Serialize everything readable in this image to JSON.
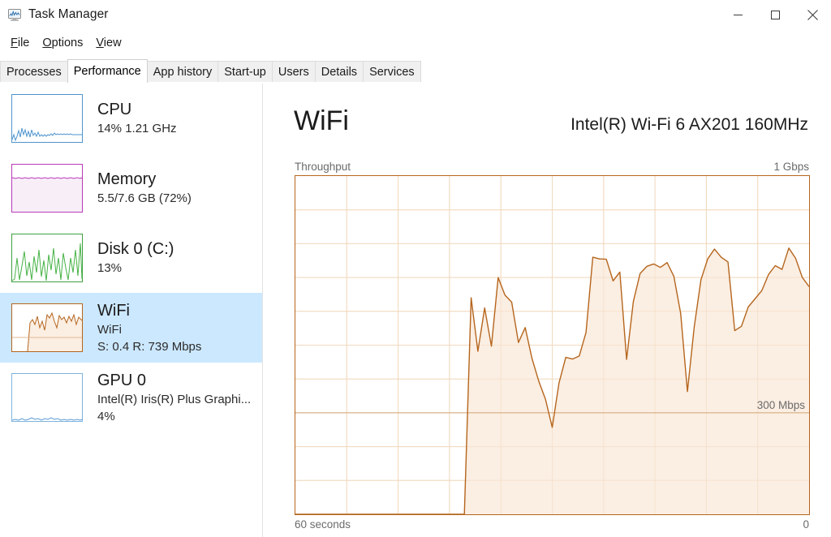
{
  "window": {
    "title": "Task Manager",
    "icon": "task-manager-icon",
    "buttons": {
      "minimize": "minimize-icon",
      "maximize": "maximize-icon",
      "close": "close-icon"
    }
  },
  "menu": {
    "items": [
      {
        "label": "File",
        "accel": "F"
      },
      {
        "label": "Options",
        "accel": "O"
      },
      {
        "label": "View",
        "accel": "V"
      }
    ]
  },
  "tabs": {
    "items": [
      {
        "label": "Processes",
        "active": false
      },
      {
        "label": "Performance",
        "active": true
      },
      {
        "label": "App history",
        "active": false
      },
      {
        "label": "Start-up",
        "active": false
      },
      {
        "label": "Users",
        "active": false
      },
      {
        "label": "Details",
        "active": false
      },
      {
        "label": "Services",
        "active": false
      }
    ]
  },
  "sidebar": {
    "items": [
      {
        "name": "cpu",
        "title": "CPU",
        "sub1": "14%  1.21 GHz",
        "sub2": "",
        "accent": "#4f94cd",
        "fill": "#ffffff",
        "selected": false
      },
      {
        "name": "memory",
        "title": "Memory",
        "sub1": "5.5/7.6 GB (72%)",
        "sub2": "",
        "accent": "#b83bb8",
        "fill": "#f8eef8",
        "selected": false
      },
      {
        "name": "disk-0",
        "title": "Disk 0 (C:)",
        "sub1": "13%",
        "sub2": "",
        "accent": "#3fa03f",
        "fill": "#ffffff",
        "selected": false
      },
      {
        "name": "wifi",
        "title": "WiFi",
        "sub1": "WiFi",
        "sub2": "S: 0.4 R: 739 Mbps",
        "accent": "#b5651d",
        "fill": "#fbeee2",
        "selected": true
      },
      {
        "name": "gpu-0",
        "title": "GPU 0",
        "sub1": "Intel(R) Iris(R) Plus Graphi...",
        "sub2": "4%",
        "accent": "#5b9bd5",
        "fill": "#ffffff",
        "selected": false
      }
    ],
    "selection_color": "#cce8ff"
  },
  "main": {
    "title": "WiFi",
    "adapter": "Intel(R) Wi-Fi 6 AX201 160MHz",
    "graph_caption_left": "Throughput",
    "graph_caption_right": "1 Gbps",
    "midline_label": "300 Mbps",
    "axis_left": "60 seconds",
    "axis_right": "0",
    "line_color": "#b5651d",
    "fill_color": "#fbeee2",
    "grid_color": "#f2d9bf"
  },
  "chart_data": {
    "type": "area",
    "title": "Throughput",
    "xlabel": "",
    "ylabel": "Throughput",
    "ylim": [
      0,
      1000
    ],
    "xlim": [
      60,
      0
    ],
    "y_unit": "Mbps",
    "y_max_label": "1 Gbps",
    "y_mid_label": "300 Mbps",
    "y_mid_value": 300,
    "x_left_label": "60 seconds",
    "x_right_label": "0",
    "grid": true,
    "legend": "none",
    "series": [
      {
        "name": "Throughput",
        "color": "#b5651d",
        "x": [
          60,
          59,
          58,
          57,
          56,
          55,
          54,
          53,
          52,
          51,
          50,
          49,
          48,
          47,
          46,
          45,
          44,
          43,
          42,
          41,
          40,
          39,
          38,
          37,
          36,
          35,
          34,
          33,
          32,
          31,
          30,
          29,
          28,
          27,
          26,
          25,
          24,
          23,
          22,
          21,
          20,
          19,
          18,
          17,
          16,
          15,
          14,
          13,
          12,
          11,
          10,
          9,
          8,
          7,
          6,
          5,
          4,
          3,
          2,
          1,
          0
        ],
        "values": [
          0,
          0,
          0,
          0,
          0,
          0,
          0,
          0,
          0,
          0,
          0,
          0,
          0,
          0,
          0,
          0,
          0,
          0,
          0,
          0,
          0,
          0,
          0,
          0,
          0,
          0,
          640,
          482,
          610,
          497,
          700,
          648,
          627,
          508,
          552,
          461,
          394,
          340,
          257,
          388,
          464,
          459,
          468,
          538,
          760,
          755,
          754,
          690,
          716,
          458,
          629,
          712,
          733,
          740,
          730,
          744,
          703,
          594,
          363,
          553,
          693,
          755,
          784,
          760,
          746,
          543,
          556,
          613,
          637,
          661,
          709,
          735,
          724,
          787,
          757,
          700,
          673
        ]
      }
    ]
  }
}
